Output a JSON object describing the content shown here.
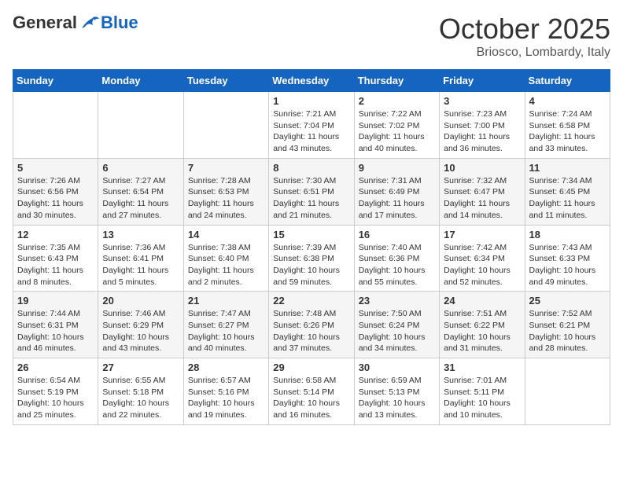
{
  "logo": {
    "general": "General",
    "blue": "Blue"
  },
  "title": "October 2025",
  "location": "Briosco, Lombardy, Italy",
  "days_header": [
    "Sunday",
    "Monday",
    "Tuesday",
    "Wednesday",
    "Thursday",
    "Friday",
    "Saturday"
  ],
  "weeks": [
    [
      {
        "day": "",
        "info": ""
      },
      {
        "day": "",
        "info": ""
      },
      {
        "day": "",
        "info": ""
      },
      {
        "day": "1",
        "info": "Sunrise: 7:21 AM\nSunset: 7:04 PM\nDaylight: 11 hours\nand 43 minutes."
      },
      {
        "day": "2",
        "info": "Sunrise: 7:22 AM\nSunset: 7:02 PM\nDaylight: 11 hours\nand 40 minutes."
      },
      {
        "day": "3",
        "info": "Sunrise: 7:23 AM\nSunset: 7:00 PM\nDaylight: 11 hours\nand 36 minutes."
      },
      {
        "day": "4",
        "info": "Sunrise: 7:24 AM\nSunset: 6:58 PM\nDaylight: 11 hours\nand 33 minutes."
      }
    ],
    [
      {
        "day": "5",
        "info": "Sunrise: 7:26 AM\nSunset: 6:56 PM\nDaylight: 11 hours\nand 30 minutes."
      },
      {
        "day": "6",
        "info": "Sunrise: 7:27 AM\nSunset: 6:54 PM\nDaylight: 11 hours\nand 27 minutes."
      },
      {
        "day": "7",
        "info": "Sunrise: 7:28 AM\nSunset: 6:53 PM\nDaylight: 11 hours\nand 24 minutes."
      },
      {
        "day": "8",
        "info": "Sunrise: 7:30 AM\nSunset: 6:51 PM\nDaylight: 11 hours\nand 21 minutes."
      },
      {
        "day": "9",
        "info": "Sunrise: 7:31 AM\nSunset: 6:49 PM\nDaylight: 11 hours\nand 17 minutes."
      },
      {
        "day": "10",
        "info": "Sunrise: 7:32 AM\nSunset: 6:47 PM\nDaylight: 11 hours\nand 14 minutes."
      },
      {
        "day": "11",
        "info": "Sunrise: 7:34 AM\nSunset: 6:45 PM\nDaylight: 11 hours\nand 11 minutes."
      }
    ],
    [
      {
        "day": "12",
        "info": "Sunrise: 7:35 AM\nSunset: 6:43 PM\nDaylight: 11 hours\nand 8 minutes."
      },
      {
        "day": "13",
        "info": "Sunrise: 7:36 AM\nSunset: 6:41 PM\nDaylight: 11 hours\nand 5 minutes."
      },
      {
        "day": "14",
        "info": "Sunrise: 7:38 AM\nSunset: 6:40 PM\nDaylight: 11 hours\nand 2 minutes."
      },
      {
        "day": "15",
        "info": "Sunrise: 7:39 AM\nSunset: 6:38 PM\nDaylight: 10 hours\nand 59 minutes."
      },
      {
        "day": "16",
        "info": "Sunrise: 7:40 AM\nSunset: 6:36 PM\nDaylight: 10 hours\nand 55 minutes."
      },
      {
        "day": "17",
        "info": "Sunrise: 7:42 AM\nSunset: 6:34 PM\nDaylight: 10 hours\nand 52 minutes."
      },
      {
        "day": "18",
        "info": "Sunrise: 7:43 AM\nSunset: 6:33 PM\nDaylight: 10 hours\nand 49 minutes."
      }
    ],
    [
      {
        "day": "19",
        "info": "Sunrise: 7:44 AM\nSunset: 6:31 PM\nDaylight: 10 hours\nand 46 minutes."
      },
      {
        "day": "20",
        "info": "Sunrise: 7:46 AM\nSunset: 6:29 PM\nDaylight: 10 hours\nand 43 minutes."
      },
      {
        "day": "21",
        "info": "Sunrise: 7:47 AM\nSunset: 6:27 PM\nDaylight: 10 hours\nand 40 minutes."
      },
      {
        "day": "22",
        "info": "Sunrise: 7:48 AM\nSunset: 6:26 PM\nDaylight: 10 hours\nand 37 minutes."
      },
      {
        "day": "23",
        "info": "Sunrise: 7:50 AM\nSunset: 6:24 PM\nDaylight: 10 hours\nand 34 minutes."
      },
      {
        "day": "24",
        "info": "Sunrise: 7:51 AM\nSunset: 6:22 PM\nDaylight: 10 hours\nand 31 minutes."
      },
      {
        "day": "25",
        "info": "Sunrise: 7:52 AM\nSunset: 6:21 PM\nDaylight: 10 hours\nand 28 minutes."
      }
    ],
    [
      {
        "day": "26",
        "info": "Sunrise: 6:54 AM\nSunset: 5:19 PM\nDaylight: 10 hours\nand 25 minutes."
      },
      {
        "day": "27",
        "info": "Sunrise: 6:55 AM\nSunset: 5:18 PM\nDaylight: 10 hours\nand 22 minutes."
      },
      {
        "day": "28",
        "info": "Sunrise: 6:57 AM\nSunset: 5:16 PM\nDaylight: 10 hours\nand 19 minutes."
      },
      {
        "day": "29",
        "info": "Sunrise: 6:58 AM\nSunset: 5:14 PM\nDaylight: 10 hours\nand 16 minutes."
      },
      {
        "day": "30",
        "info": "Sunrise: 6:59 AM\nSunset: 5:13 PM\nDaylight: 10 hours\nand 13 minutes."
      },
      {
        "day": "31",
        "info": "Sunrise: 7:01 AM\nSunset: 5:11 PM\nDaylight: 10 hours\nand 10 minutes."
      },
      {
        "day": "",
        "info": ""
      }
    ]
  ]
}
